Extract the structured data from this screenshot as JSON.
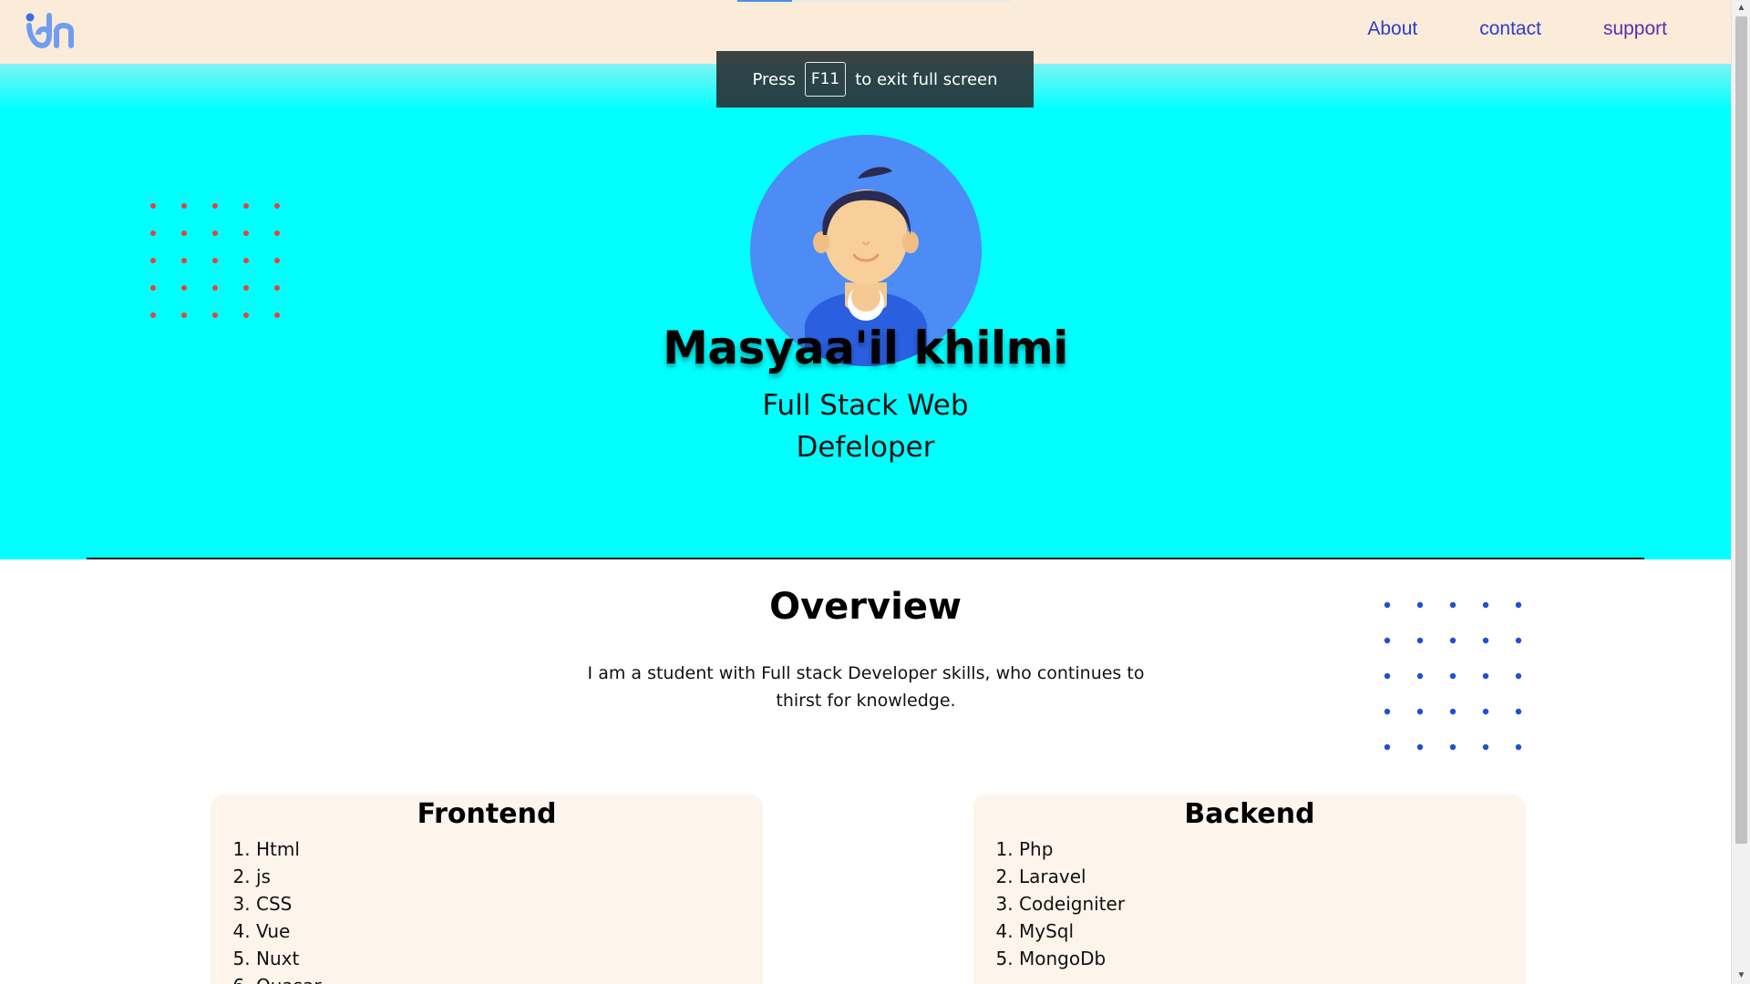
{
  "nav": {
    "links": [
      "About",
      "contact",
      "support"
    ],
    "logo_icon": "idn-logo"
  },
  "fullscreen_notice": {
    "prefix": "Press",
    "key": "F11",
    "suffix": "to exit full screen"
  },
  "hero": {
    "name": "Masyaa'il khilmi",
    "role_line1": "Full Stack Web",
    "role_line2": "Defeloper",
    "avatar_icon": "user-avatar-icon"
  },
  "overview": {
    "title": "Overview",
    "text": "I am a student with Full stack Developer skills, who continues to thirst for knowledge."
  },
  "skills": {
    "frontend": {
      "title": "Frontend",
      "items": [
        "Html",
        "js",
        "CSS",
        "Vue",
        "Nuxt",
        "Quasar"
      ]
    },
    "backend": {
      "title": "Backend",
      "items": [
        "Php",
        "Laravel",
        "Codeigniter",
        "MySql",
        "MongoDb"
      ]
    }
  },
  "colors": {
    "navbar_bg": "#fbebd9",
    "hero_bg": "#00ffff",
    "nav_link": "#2c3dc9",
    "dots_red": "#e8413c",
    "dots_blue": "#1e4fd6",
    "card_bg": "#fdf4ec"
  }
}
